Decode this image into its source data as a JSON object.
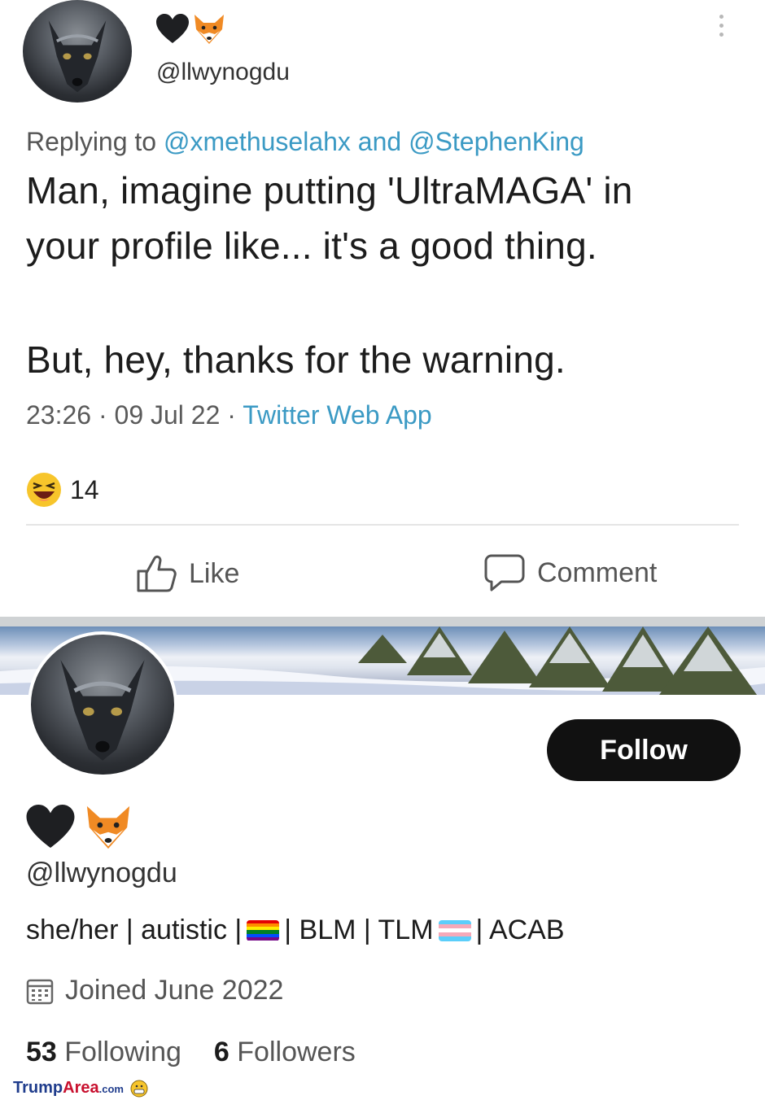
{
  "tweet": {
    "name_emojis": [
      "black-heart",
      "fox-face"
    ],
    "handle": "@llwynogdu",
    "replying_prefix": "Replying to",
    "reply_mention_1": "@xmethuselahx",
    "reply_and": "and",
    "reply_mention_2": "@StephenKing",
    "text_line_1": "Man, imagine putting 'UltraMAGA' in",
    "text_line_2": "your profile like... it's a good thing.",
    "text_line_3": "But, hey, thanks for the warning.",
    "time": "23:26",
    "date": "09 Jul 22",
    "source": "Twitter Web App",
    "reaction_count": "14",
    "like_label": "Like",
    "comment_label": "Comment"
  },
  "profile": {
    "name_emojis": [
      "black-heart",
      "fox-face"
    ],
    "handle": "@llwynogdu",
    "follow_label": "Follow",
    "bio_part_1": "she/her | autistic |",
    "bio_part_2": "| BLM | TLM",
    "bio_part_3": "| ACAB",
    "joined": "Joined June 2022",
    "following_count": "53",
    "following_label": "Following",
    "followers_count": "6",
    "followers_label": "Followers"
  },
  "watermark": {
    "brand_1": "Trump",
    "brand_2": "Area",
    "brand_3": ".com"
  },
  "colors": {
    "link": "#3b9ac4",
    "follow_button": "#111111",
    "pride_flag": [
      "#e40303",
      "#ff8c00",
      "#ffed00",
      "#008026",
      "#004dff",
      "#750787"
    ],
    "trans_flag": [
      "#5bcefa",
      "#f5a9b8",
      "#ffffff",
      "#f5a9b8",
      "#5bcefa"
    ]
  }
}
